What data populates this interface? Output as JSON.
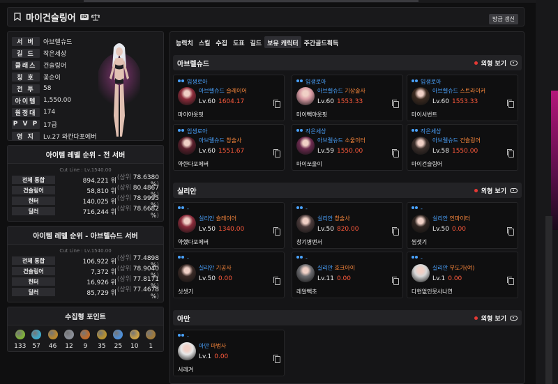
{
  "header": {
    "title": "마이건슬링어",
    "refresh_label": "방금 갱신"
  },
  "profile": {
    "rows": [
      {
        "label": "서 버",
        "value": "아브렐슈드"
      },
      {
        "label": "길 드",
        "value": "작은세상"
      },
      {
        "label": "클래스",
        "value": "건슬링어"
      },
      {
        "label": "칭 호",
        "value": "꽃순이"
      },
      {
        "label": "전 투",
        "value": "58"
      },
      {
        "label": "아이템",
        "value": "1,550.00"
      },
      {
        "label": "원정대",
        "value": "174"
      },
      {
        "label": "P V P",
        "value": "17급"
      },
      {
        "label": "영 지",
        "value": "Lv.27 와칸다포에버"
      }
    ]
  },
  "rank_all": {
    "title": "아이템 레벨 순위 - 전 서버",
    "cutline": "Cut Line : Lv.1540.00",
    "rows": [
      {
        "label": "전체 통합",
        "rank": "894,221 위",
        "pct": "78.6380 %"
      },
      {
        "label": "건슬링어",
        "rank": "58,810 위",
        "pct": "80.4867 %"
      },
      {
        "label": "헌터",
        "rank": "140,025 위",
        "pct": "78.9995 %"
      },
      {
        "label": "딜러",
        "rank": "716,244 위",
        "pct": "78.6682 %"
      }
    ]
  },
  "rank_server": {
    "title": "아이템 레벨 순위 - 아브렐슈드 서버",
    "cutline": "Cut Line : Lv.1540.00",
    "rows": [
      {
        "label": "전체 통합",
        "rank": "106,922 위",
        "pct": "77.4898 %"
      },
      {
        "label": "건슬링어",
        "rank": "7,372 위",
        "pct": "78.9040 %"
      },
      {
        "label": "헌터",
        "rank": "16,926 위",
        "pct": "77.8171 %"
      },
      {
        "label": "딜러",
        "rank": "85,729 위",
        "pct": "77.4678 %"
      }
    ]
  },
  "rank_prefix": "(상위",
  "rank_suffix": ")",
  "collect": {
    "title": "수집형 포인트",
    "items": [
      {
        "icon": "mokoko-seed-icon",
        "value": "133",
        "color": "#7fb13a"
      },
      {
        "icon": "island-heart-icon",
        "value": "57",
        "color": "#3fa8c8"
      },
      {
        "icon": "great-art-icon",
        "value": "46",
        "color": "#b8872d"
      },
      {
        "icon": "giant-heart-icon",
        "value": "12",
        "color": "#8a8f98"
      },
      {
        "icon": "ignea-token-icon",
        "value": "9",
        "color": "#c06a2a"
      },
      {
        "icon": "adventure-tome-icon",
        "value": "35",
        "color": "#b7912f"
      },
      {
        "icon": "world-tree-leaf-icon",
        "value": "25",
        "color": "#4e8fd8"
      },
      {
        "icon": "orpheus-star-icon",
        "value": "10",
        "color": "#caa045"
      },
      {
        "icon": "sea-bounty-icon",
        "value": "1",
        "color": "#a07a3a"
      }
    ]
  },
  "tabs": [
    "능력치",
    "스킬",
    "수집",
    "도표",
    "길드",
    "보유 캐릭터",
    "주간골드획득"
  ],
  "active_tab": 5,
  "toggle_label": "외형 보기",
  "sections": [
    {
      "title": "아브렐슈드",
      "cards": [
        {
          "guild": "입생로아",
          "server": "아브렐슈드",
          "cls": "슬레이어",
          "lv": "Lv.60",
          "il": "1604.17",
          "nick": "마이야옷핏",
          "avatar": "#8a2b3a"
        },
        {
          "guild": "입생로아",
          "server": "아브렐슈드",
          "cls": "기상술사",
          "lv": "Lv.60",
          "il": "1553.33",
          "nick": "마이빽야옷핏",
          "avatar": "#d79aa3"
        },
        {
          "guild": "입생로아",
          "server": "아브렐슈드",
          "cls": "스트라이커",
          "lv": "Lv.60",
          "il": "1553.33",
          "nick": "마이서번트",
          "avatar": "#3b2a20"
        },
        {
          "guild": "입생로아",
          "server": "아브렐슈드",
          "cls": "창술사",
          "lv": "Lv.60",
          "il": "1551.67",
          "nick": "약한다포에버",
          "avatar": "#5a1f2c"
        },
        {
          "guild": "작은세상",
          "server": "아브렐슈드",
          "cls": "소울이터",
          "lv": "Lv.59",
          "il": "1550.00",
          "nick": "마이쏘울이",
          "avatar": "#6b2a4e"
        },
        {
          "guild": "작은세상",
          "server": "아브렐슈드",
          "cls": "건슬링어",
          "lv": "Lv.58",
          "il": "1550.00",
          "nick": "마이건슬링어",
          "avatar": "#3a2e2a"
        }
      ]
    },
    {
      "title": "실리안",
      "cards": [
        {
          "guild": "-",
          "server": "실리안",
          "cls": "슬레이어",
          "lv": "Lv.50",
          "il": "1340.00",
          "nick": "약했다포에버",
          "avatar": "#8a2b3a"
        },
        {
          "guild": "-",
          "server": "실리안",
          "cls": "창술사",
          "lv": "Lv.50",
          "il": "820.00",
          "nick": "창기병맨서",
          "avatar": "#4a3a3a"
        },
        {
          "guild": "-",
          "server": "실리안",
          "cls": "인파이터",
          "lv": "Lv.50",
          "il": "0.00",
          "nick": "씹셋기",
          "avatar": "#2e2420"
        },
        {
          "guild": "-",
          "server": "실리안",
          "cls": "기공사",
          "lv": "Lv.50",
          "il": "0.00",
          "nick": "싯셋기",
          "avatar": "#3a2a26"
        },
        {
          "guild": "-",
          "server": "실리안",
          "cls": "호크아이",
          "lv": "Lv.11",
          "il": "0.00",
          "nick": "레알빽초",
          "avatar": "#6a6a6e"
        },
        {
          "guild": "-",
          "server": "실리안",
          "cls": "무도가(여)",
          "lv": "Lv.1",
          "il": "0.00",
          "nick": "다현없인못사나연",
          "avatar": "#d8d8d8"
        }
      ]
    },
    {
      "title": "아만",
      "cards": [
        {
          "guild": "-",
          "server": "아만",
          "cls": "마법사",
          "lv": "Lv.1",
          "il": "0.00",
          "nick": "서레겨",
          "avatar": "#e8e8e8"
        }
      ]
    }
  ]
}
